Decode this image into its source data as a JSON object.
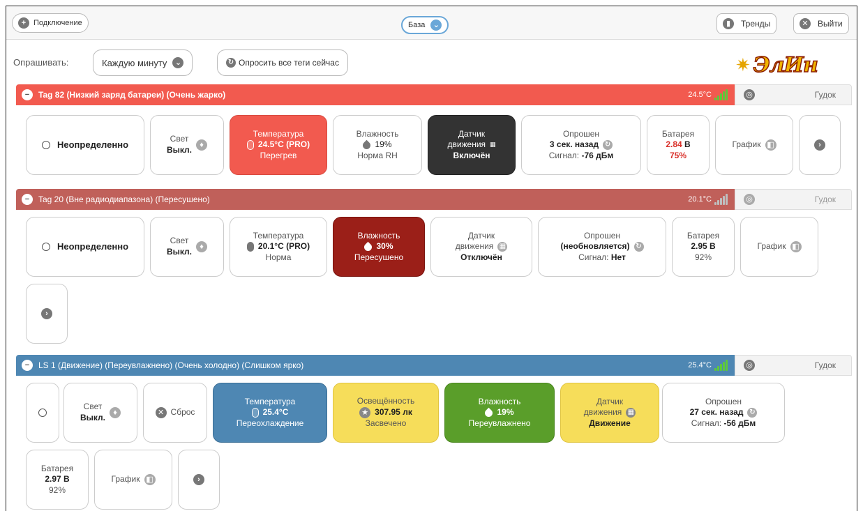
{
  "topbar": {
    "connection_label": "Подключение",
    "base_label": "База",
    "trends_label": "Тренды",
    "logout_label": "Выйти"
  },
  "poll": {
    "label": "Опрашивать:",
    "interval_selected": "Каждую минуту",
    "poll_all_label": "Опросить все теги сейчас"
  },
  "logo": {
    "text": "ЭлИн"
  },
  "tags": [
    {
      "title": "Tag 82",
      "status": "(Низкий заряд батареи) (Очень жарко)",
      "temp": "24.5°C",
      "color": "#f25a4f",
      "beep_label": "Гудок",
      "state_label": "Неопределенно",
      "light_label": "Свет",
      "light_value": "Выкл.",
      "temp_label": "Температура",
      "temp_value": "24.5°C (PRO)",
      "temp_note": "Перегрев",
      "hum_label": "Влажность",
      "hum_value": "19%",
      "hum_note": "Норма RH",
      "motion_label1": "Датчик",
      "motion_label2": "движения",
      "motion_value": "Включён",
      "polled_label": "Опрошен",
      "polled_value": "3 сек. назад",
      "signal_label": "Сигнал:",
      "signal_value": "-76 дБм",
      "battery_label": "Батарея",
      "battery_volt": "2.84",
      "battery_unit": "В",
      "battery_pct": "75%",
      "graph_label": "График"
    },
    {
      "title": "Tag 20",
      "status": "(Вне радиодиапазона) (Пересушено)",
      "temp": "20.1°C",
      "color": "#c0605a",
      "beep_label": "Гудок",
      "state_label": "Неопределенно",
      "light_label": "Свет",
      "light_value": "Выкл.",
      "temp_label": "Температура",
      "temp_value": "20.1°C (PRO)",
      "temp_note": "Норма",
      "hum_label": "Влажность",
      "hum_value": "30%",
      "hum_note": "Пересушено",
      "motion_label1": "Датчик",
      "motion_label2": "движения",
      "motion_value": "Отключён",
      "polled_label": "Опрошен",
      "polled_value": "(необновляется)",
      "signal_label": "Сигнал:",
      "signal_value": "Нет",
      "battery_label": "Батарея",
      "battery_value": "2.95 В",
      "battery_pct": "92%",
      "graph_label": "График"
    },
    {
      "title": "LS 1",
      "status": "(Движение) (Переувлажнено) (Очень холодно) (Слишком ярко)",
      "temp": "25.4°C",
      "color": "#4e87b3",
      "beep_label": "Гудок",
      "light_label": "Свет",
      "light_value": "Выкл.",
      "reset_label": "Сброс",
      "temp_label": "Температура",
      "temp_value": "25.4°C",
      "temp_note": "Переохлаждение",
      "lux_label": "Освещённость",
      "lux_value": "307.95 лк",
      "lux_note": "Засвечено",
      "hum_label": "Влажность",
      "hum_value": "19%",
      "hum_note": "Переувлажнено",
      "motion_label1": "Датчик",
      "motion_label2": "движения",
      "motion_value": "Движение",
      "polled_label": "Опрошен",
      "polled_value": "27 сек. назад",
      "signal_label": "Сигнал:",
      "signal_value": "-56 дБм",
      "battery_label": "Батарея",
      "battery_value": "2.97 В",
      "battery_pct": "92%",
      "graph_label": "График"
    }
  ]
}
